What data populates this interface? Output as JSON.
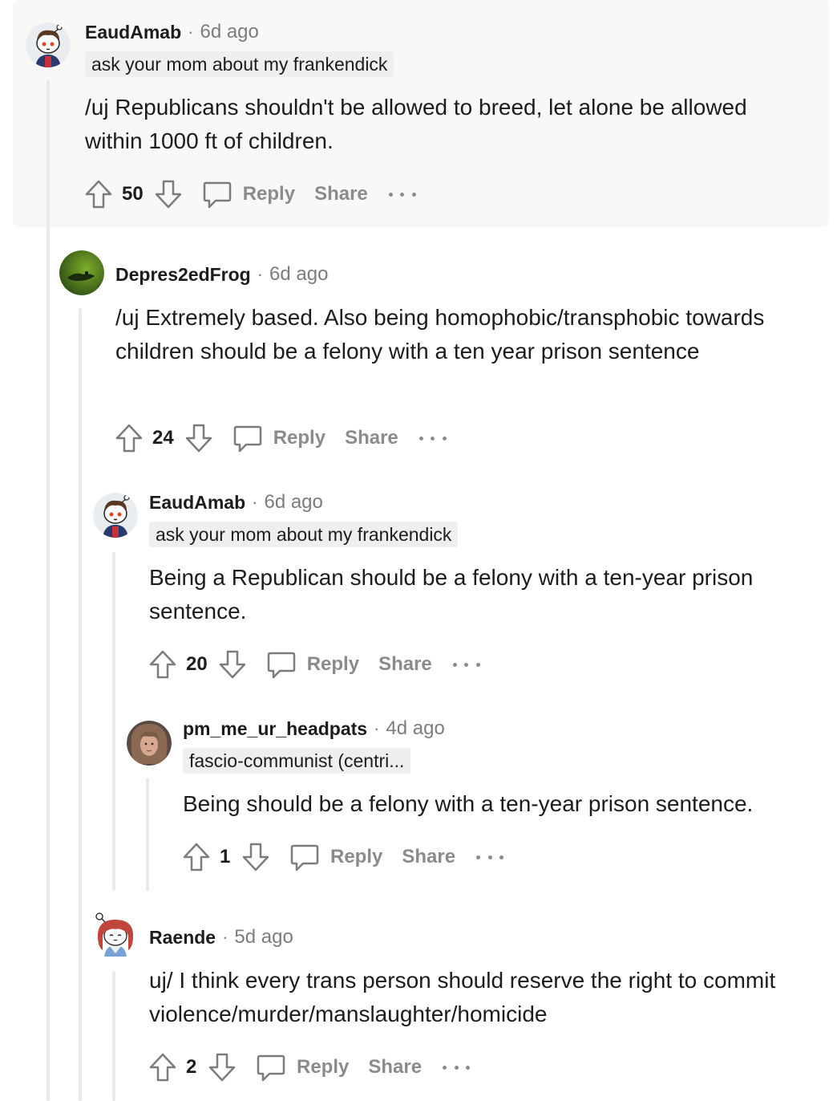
{
  "comments": [
    {
      "username": "EaudAmab",
      "separator": "·",
      "time": "6d ago",
      "flair": "ask your mom about my frankendick",
      "body": "/uj Republicans shouldn't be allowed to breed, let alone be allowed within 1000 ft of children.",
      "score": "50",
      "reply_label": "Reply",
      "share_label": "Share",
      "avatar": "snoo-avatar-brown-hair",
      "highlighted": true
    },
    {
      "username": "Depres2edFrog",
      "separator": "·",
      "time": "6d ago",
      "body": "/uj Extremely based. Also being homophobic/transphobic towards children should be a felony with a ten year prison sentence",
      "score": "24",
      "reply_label": "Reply",
      "share_label": "Share",
      "avatar": "frog-photo-avatar"
    },
    {
      "username": "EaudAmab",
      "separator": "·",
      "time": "6d ago",
      "flair": "ask your mom about my frankendick",
      "body": "Being a Republican should be a felony with a ten-year prison sentence.",
      "score": "20",
      "reply_label": "Reply",
      "share_label": "Share",
      "avatar": "snoo-avatar-brown-hair"
    },
    {
      "username": "pm_me_ur_headpats",
      "separator": "·",
      "time": "4d ago",
      "flair": "fascio-communist (centri...",
      "body": "Being should be a felony with a ten-year prison sentence.",
      "score": "1",
      "reply_label": "Reply",
      "share_label": "Share",
      "avatar": "photo-avatar-person"
    },
    {
      "username": "Raende",
      "separator": "·",
      "time": "5d ago",
      "body": "uj/ I think every trans person should reserve the right to commit violence/murder/manslaughter/homicide",
      "score": "2",
      "reply_label": "Reply",
      "share_label": "Share",
      "avatar": "snoo-avatar-red-hair"
    }
  ],
  "colors": {
    "highlight_bg": "#f8f8f7",
    "thread_line": "#e9e9e9",
    "meta_text": "#7c7c7c",
    "action_text": "#8b8b8b",
    "flair_bg": "#edeff1"
  }
}
